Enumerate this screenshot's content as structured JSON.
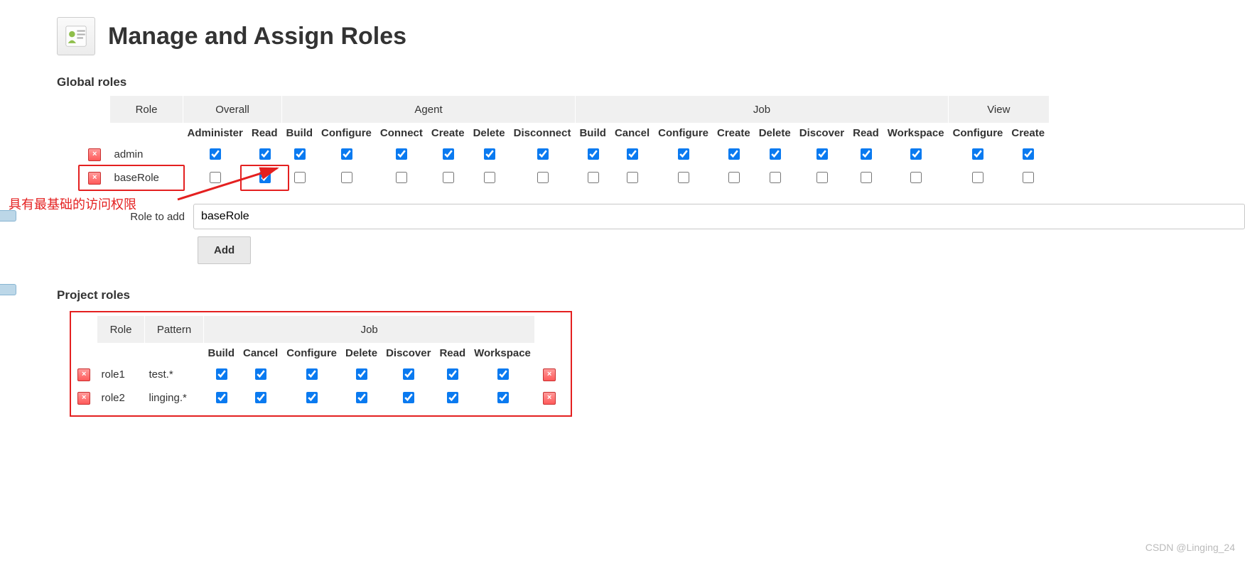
{
  "page_title": "Manage and Assign Roles",
  "sections": {
    "global": "Global roles",
    "project": "Project roles"
  },
  "global_table": {
    "role_header": "Role",
    "groups": [
      "Overall",
      "Agent",
      "Job",
      "View"
    ],
    "group_spans": [
      2,
      6,
      8,
      2
    ],
    "perms": [
      "Administer",
      "Read",
      "Build",
      "Configure",
      "Connect",
      "Create",
      "Delete",
      "Disconnect",
      "Build",
      "Cancel",
      "Configure",
      "Create",
      "Delete",
      "Discover",
      "Read",
      "Workspace",
      "Configure",
      "Create"
    ],
    "rows": [
      {
        "name": "admin",
        "checks": [
          true,
          true,
          true,
          true,
          true,
          true,
          true,
          true,
          true,
          true,
          true,
          true,
          true,
          true,
          true,
          true,
          true,
          true
        ]
      },
      {
        "name": "baseRole",
        "checks": [
          false,
          true,
          false,
          false,
          false,
          false,
          false,
          false,
          false,
          false,
          false,
          false,
          false,
          false,
          false,
          false,
          false,
          false
        ]
      }
    ]
  },
  "role_to_add": {
    "label": "Role to add",
    "value": "baseRole",
    "button": "Add"
  },
  "project_table": {
    "role_header": "Role",
    "pattern_header": "Pattern",
    "group": "Job",
    "perms": [
      "Build",
      "Cancel",
      "Configure",
      "Delete",
      "Discover",
      "Read",
      "Workspace"
    ],
    "rows": [
      {
        "name": "role1",
        "pattern": "test.*",
        "checks": [
          true,
          true,
          true,
          true,
          true,
          true,
          true
        ]
      },
      {
        "name": "role2",
        "pattern": "linging.*",
        "checks": [
          true,
          true,
          true,
          true,
          true,
          true,
          true
        ]
      }
    ]
  },
  "annotation_text": "具有最基础的访问权限",
  "watermark": "CSDN @Linging_24"
}
